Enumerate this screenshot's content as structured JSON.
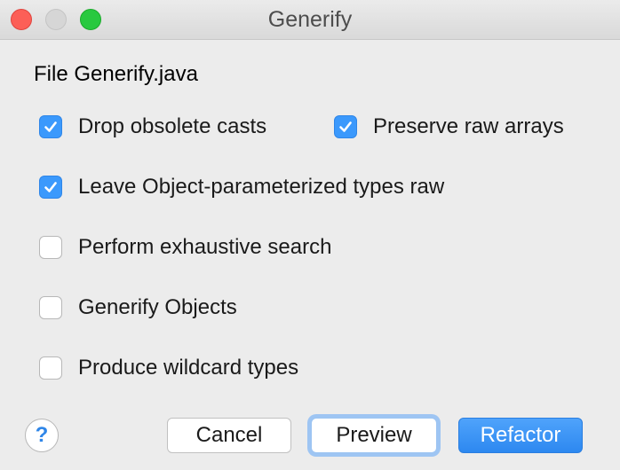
{
  "window": {
    "title": "Generify"
  },
  "file_label": "File Generify.java",
  "options": [
    {
      "label": "Drop obsolete casts",
      "checked": true
    },
    {
      "label": "Preserve raw arrays",
      "checked": true
    },
    {
      "label": "Leave Object-parameterized types raw",
      "checked": true
    },
    {
      "label": "Perform exhaustive search",
      "checked": false
    },
    {
      "label": "Generify Objects",
      "checked": false
    },
    {
      "label": "Produce wildcard types",
      "checked": false
    }
  ],
  "buttons": {
    "help": "?",
    "cancel": "Cancel",
    "preview": "Preview",
    "refactor": "Refactor"
  },
  "colors": {
    "accent": "#3b99fc",
    "close": "#fc5f57",
    "zoom": "#28c93f"
  }
}
